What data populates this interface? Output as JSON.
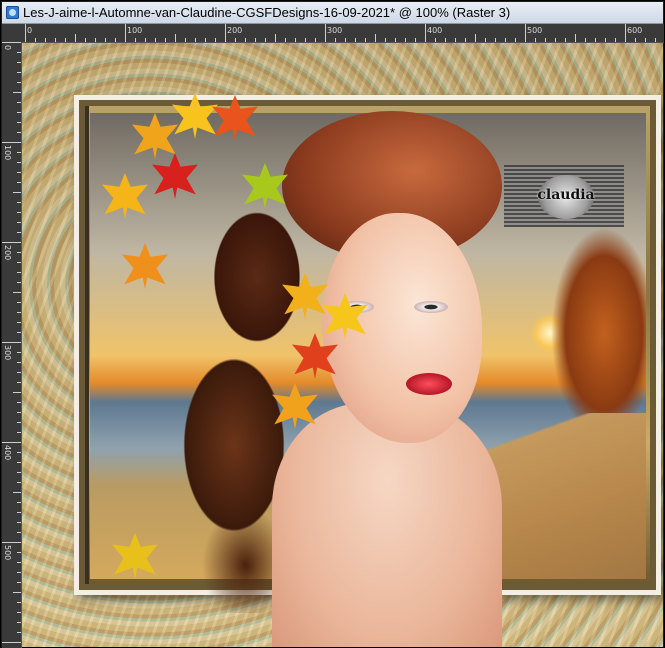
{
  "window": {
    "title": "Les-J-aime-l-Automne-van-Claudine-CGSFDesigns-16-09-2021* @ 100% (Raster 3)",
    "icon": "image-document-icon"
  },
  "ruler": {
    "h_labels": [
      "0",
      "100",
      "200",
      "300",
      "400",
      "500",
      "600"
    ],
    "v_labels": [
      "0",
      "100",
      "200",
      "300",
      "400",
      "500"
    ]
  },
  "artwork": {
    "watermark_text": "claudia"
  },
  "colors": {
    "title_bg": "#dbe3ee",
    "ruler_bg": "#3a3a3a",
    "frame_light": "#f4efe4"
  }
}
